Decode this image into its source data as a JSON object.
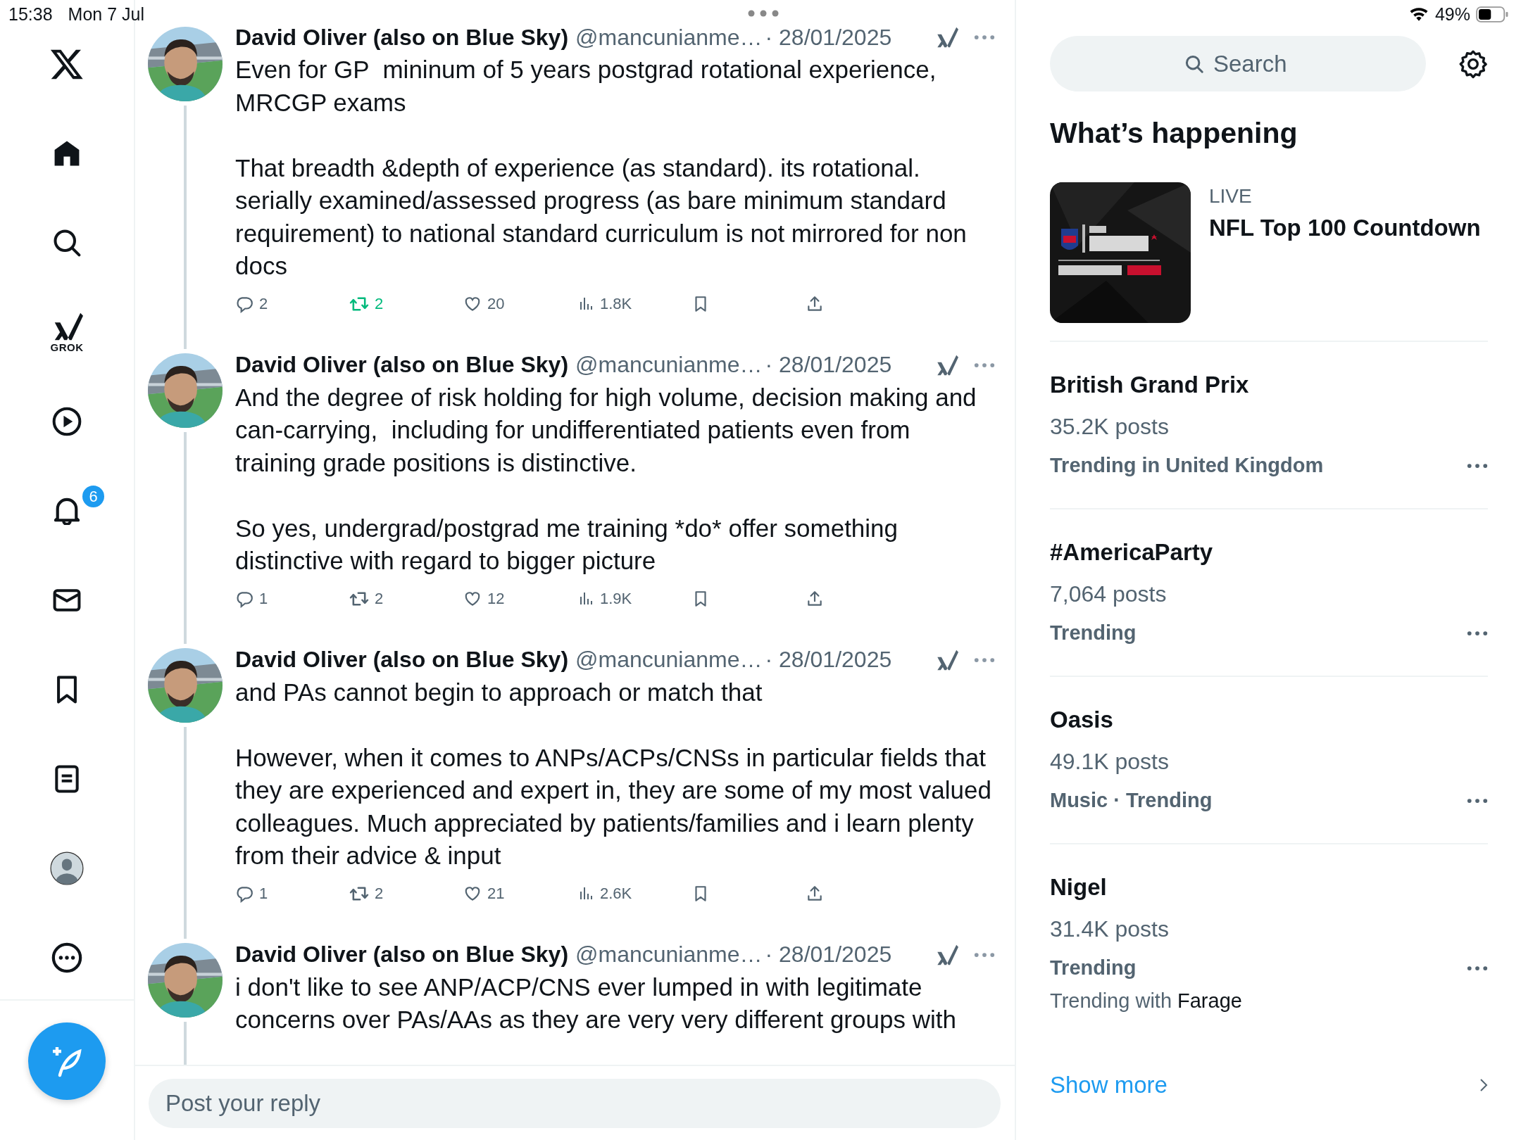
{
  "status_bar": {
    "time": "15:38",
    "date": "Mon 7 Jul",
    "battery": "49%"
  },
  "sidebar": {
    "items": [
      {
        "kind": "logo"
      },
      {
        "kind": "home"
      },
      {
        "kind": "search"
      },
      {
        "kind": "grok",
        "label": "GROK"
      },
      {
        "kind": "video"
      },
      {
        "kind": "notifications",
        "badge": "6"
      },
      {
        "kind": "messages"
      },
      {
        "kind": "bookmarks"
      },
      {
        "kind": "lists"
      },
      {
        "kind": "profile"
      },
      {
        "kind": "more"
      }
    ]
  },
  "tweets": [
    {
      "author": "David Oliver (also on Blue Sky)",
      "handle": "@mancunianme…",
      "date": "· 28/01/2025",
      "body": [
        "Even for GP  mininum of 5 years postgrad rotational experience, MRCGP exams",
        "That breadth &depth of experience (as standard). its rotational. serially examined/assessed progress (as bare minimum standard requirement) to national standard curriculum is not mirrored for non docs"
      ],
      "replies": "2",
      "retweets": "2",
      "retweeted": true,
      "likes": "20",
      "views": "1.8K"
    },
    {
      "author": "David Oliver (also on Blue Sky)",
      "handle": "@mancunianme…",
      "date": "· 28/01/2025",
      "body": [
        "And the degree of risk holding for high volume, decision making and can-carrying,  including for undifferentiated patients even from training grade positions is distinctive.",
        "So yes, undergrad/postgrad me training *do* offer something distinctive with regard to bigger picture"
      ],
      "replies": "1",
      "retweets": "2",
      "retweeted": false,
      "likes": "12",
      "views": "1.9K"
    },
    {
      "author": "David Oliver (also on Blue Sky)",
      "handle": "@mancunianme…",
      "date": "· 28/01/2025",
      "body": [
        "and PAs cannot begin to approach or match that",
        "However, when it comes to ANPs/ACPs/CNSs in particular fields that they are experienced and expert in, they are some of my most valued colleagues. Much appreciated by patients/families and i learn plenty from their advice & input"
      ],
      "replies": "1",
      "retweets": "2",
      "retweeted": false,
      "likes": "21",
      "views": "2.6K"
    },
    {
      "author": "David Oliver (also on Blue Sky)",
      "handle": "@mancunianme…",
      "date": "· 28/01/2025",
      "body": [
        "i don't like to see ANP/ACP/CNS ever lumped in with legitimate concerns over PAs/AAs as they are very very different groups with"
      ]
    }
  ],
  "reply_box": {
    "placeholder": "Post your reply"
  },
  "search": {
    "placeholder": "Search"
  },
  "trends": {
    "heading": "What’s happening",
    "featured": {
      "kind": "picture",
      "tag": "LIVE",
      "title": "NFL Top 100 Countdown"
    },
    "items": [
      {
        "title": "British Grand Prix",
        "posts": "35.2K posts",
        "meta": "Trending in United Kingdom"
      },
      {
        "title": "#AmericaParty",
        "posts": "7,064 posts",
        "meta": "Trending"
      },
      {
        "title": "Oasis",
        "posts": "49.1K posts",
        "meta": "Music · Trending"
      },
      {
        "title": "Nigel",
        "posts": "31.4K posts",
        "meta": "Trending",
        "with_label": "Trending with",
        "with_name": "Farage"
      }
    ],
    "show_more": "Show more"
  }
}
